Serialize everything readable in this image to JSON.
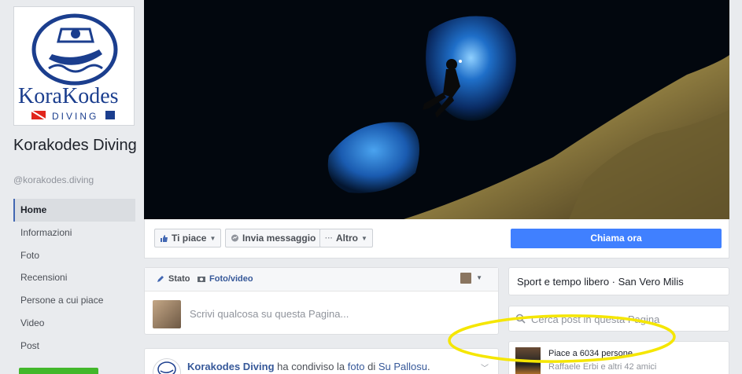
{
  "page": {
    "name": "Korakodes Diving",
    "handle": "@korakodes.diving",
    "logo_text": "KoraKodes",
    "logo_subtext": "DIVING"
  },
  "nav": {
    "items": [
      {
        "label": "Home",
        "active": true
      },
      {
        "label": "Informazioni"
      },
      {
        "label": "Foto"
      },
      {
        "label": "Recensioni"
      },
      {
        "label": "Persone a cui piace"
      },
      {
        "label": "Video"
      },
      {
        "label": "Post"
      }
    ]
  },
  "actions": {
    "like_label": "Ti piace",
    "message_label": "Invia messaggio",
    "more_label": "Altro",
    "call_label": "Chiama ora"
  },
  "composer": {
    "tab_status": "Stato",
    "tab_photo": "Foto/video",
    "placeholder": "Scrivi qualcosa su questa Pagina..."
  },
  "post": {
    "author": "Korakodes Diving",
    "verb": "ha condiviso la",
    "object": "foto",
    "of": "di",
    "source": "Su Pallosu",
    "suffix": "."
  },
  "sidebar": {
    "category": "Sport e tempo libero · San Vero Milis",
    "search_placeholder": "Cerca post in questa Pagina",
    "likes_count": "Piace a 6034 persone",
    "likes_friends": "Raffaele Erbi e altri 42 amici"
  },
  "colors": {
    "brand_blue": "#4267b2",
    "call_button": "#4080ff",
    "link": "#365899",
    "annotation": "#f5e600",
    "logo_blue": "#1b3e8e"
  }
}
